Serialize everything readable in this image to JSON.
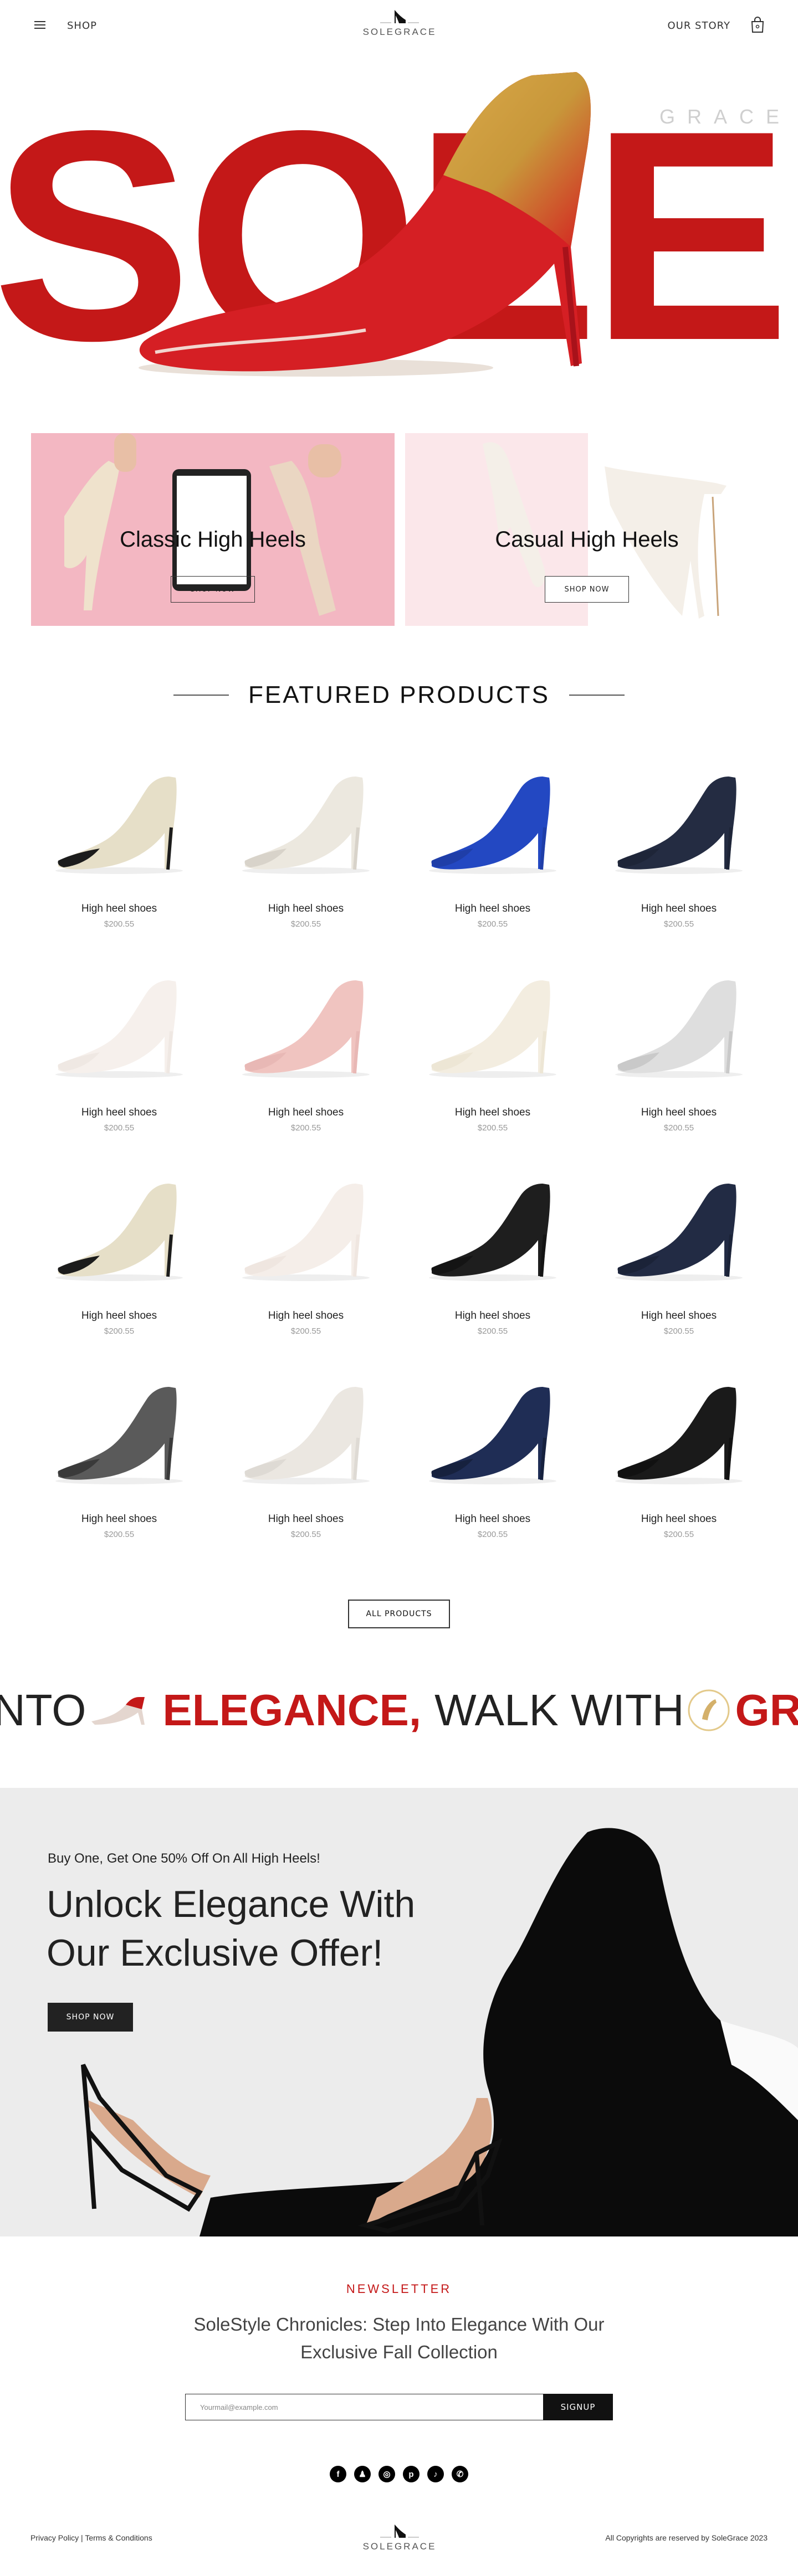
{
  "header": {
    "shop_label": "SHOP",
    "brand": "SOLEGRACE",
    "story_label": "OUR STORY"
  },
  "hero": {
    "word": "SOLE",
    "tagline": "GRACE"
  },
  "categories": [
    {
      "title": "Classic High Heels",
      "button": "SHOP NOW"
    },
    {
      "title": "Casual High Heels",
      "button": "SHOP NOW"
    }
  ],
  "featured": {
    "title": "FEATURED PRODUCTS",
    "products": [
      {
        "name": "High heel shoes",
        "price": "$200.55",
        "color": "#1c1c1c",
        "body": "#e6dfc8"
      },
      {
        "name": "High heel shoes",
        "price": "$200.55",
        "color": "#d8d3ca",
        "body": "#ece8df"
      },
      {
        "name": "High heel shoes",
        "price": "$200.55",
        "color": "#1f3ea8",
        "body": "#2348c2"
      },
      {
        "name": "High heel shoes",
        "price": "$200.55",
        "color": "#1e2538",
        "body": "#242c42"
      },
      {
        "name": "High heel shoes",
        "price": "$200.55",
        "color": "#efe8e3",
        "body": "#f6f0ec"
      },
      {
        "name": "High heel shoes",
        "price": "$200.55",
        "color": "#e8b8b5",
        "body": "#f0c4c0"
      },
      {
        "name": "High heel shoes",
        "price": "$200.55",
        "color": "#ede6d5",
        "body": "#f3ede0"
      },
      {
        "name": "High heel shoes",
        "price": "$200.55",
        "color": "#c9c9c9",
        "body": "#dedede"
      },
      {
        "name": "High heel shoes",
        "price": "$200.55",
        "color": "#1c1c1c",
        "body": "#e6dfc8"
      },
      {
        "name": "High heel shoes",
        "price": "$200.55",
        "color": "#efe6e0",
        "body": "#f5eee9"
      },
      {
        "name": "High heel shoes",
        "price": "$200.55",
        "color": "#141414",
        "body": "#1e1e1e"
      },
      {
        "name": "High heel shoes",
        "price": "$200.55",
        "color": "#1b2338",
        "body": "#222b44"
      },
      {
        "name": "High heel shoes",
        "price": "$200.55",
        "color": "#3a3a3a",
        "body": "#5a5a5a"
      },
      {
        "name": "High heel shoes",
        "price": "$200.55",
        "color": "#dedad4",
        "body": "#ebe7e1"
      },
      {
        "name": "High heel shoes",
        "price": "$200.55",
        "color": "#16213e",
        "body": "#1f2d55"
      },
      {
        "name": "High heel shoes",
        "price": "$200.55",
        "color": "#111111",
        "body": "#1a1a1a"
      }
    ],
    "all_button": "ALL PRODUCTS"
  },
  "marquee": {
    "part1": "NTO",
    "part2": "ELEGANCE,",
    "part3": "WALK WITH",
    "part4": "GRAC"
  },
  "promo": {
    "eyebrow": "Buy One, Get One 50% Off On All High Heels!",
    "title_line1": "Unlock Elegance With",
    "title_line2": "Our Exclusive Offer!",
    "button": "SHOP NOW"
  },
  "newsletter": {
    "label": "NEWSLETTER",
    "title": "SoleStyle Chronicles: Step Into Elegance With Our Exclusive Fall Collection",
    "placeholder": "Yourmail@example.com",
    "button": "SIGNUP"
  },
  "socials": [
    {
      "icon": "facebook-icon",
      "glyph": "f"
    },
    {
      "icon": "snapchat-icon",
      "glyph": "♟"
    },
    {
      "icon": "instagram-icon",
      "glyph": "◎"
    },
    {
      "icon": "pinterest-icon",
      "glyph": "p"
    },
    {
      "icon": "tiktok-icon",
      "glyph": "♪"
    },
    {
      "icon": "whatsapp-icon",
      "glyph": "✆"
    }
  ],
  "footer": {
    "privacy": "Privacy Policy",
    "separator": "|",
    "terms": "Terms & Conditions",
    "brand": "SOLEGRACE",
    "copyright": "All Copyrights are reserved by SoleGrace 2023"
  },
  "colors": {
    "accent": "#c41818",
    "dark": "#111111",
    "pink": "#f3b7c2"
  }
}
